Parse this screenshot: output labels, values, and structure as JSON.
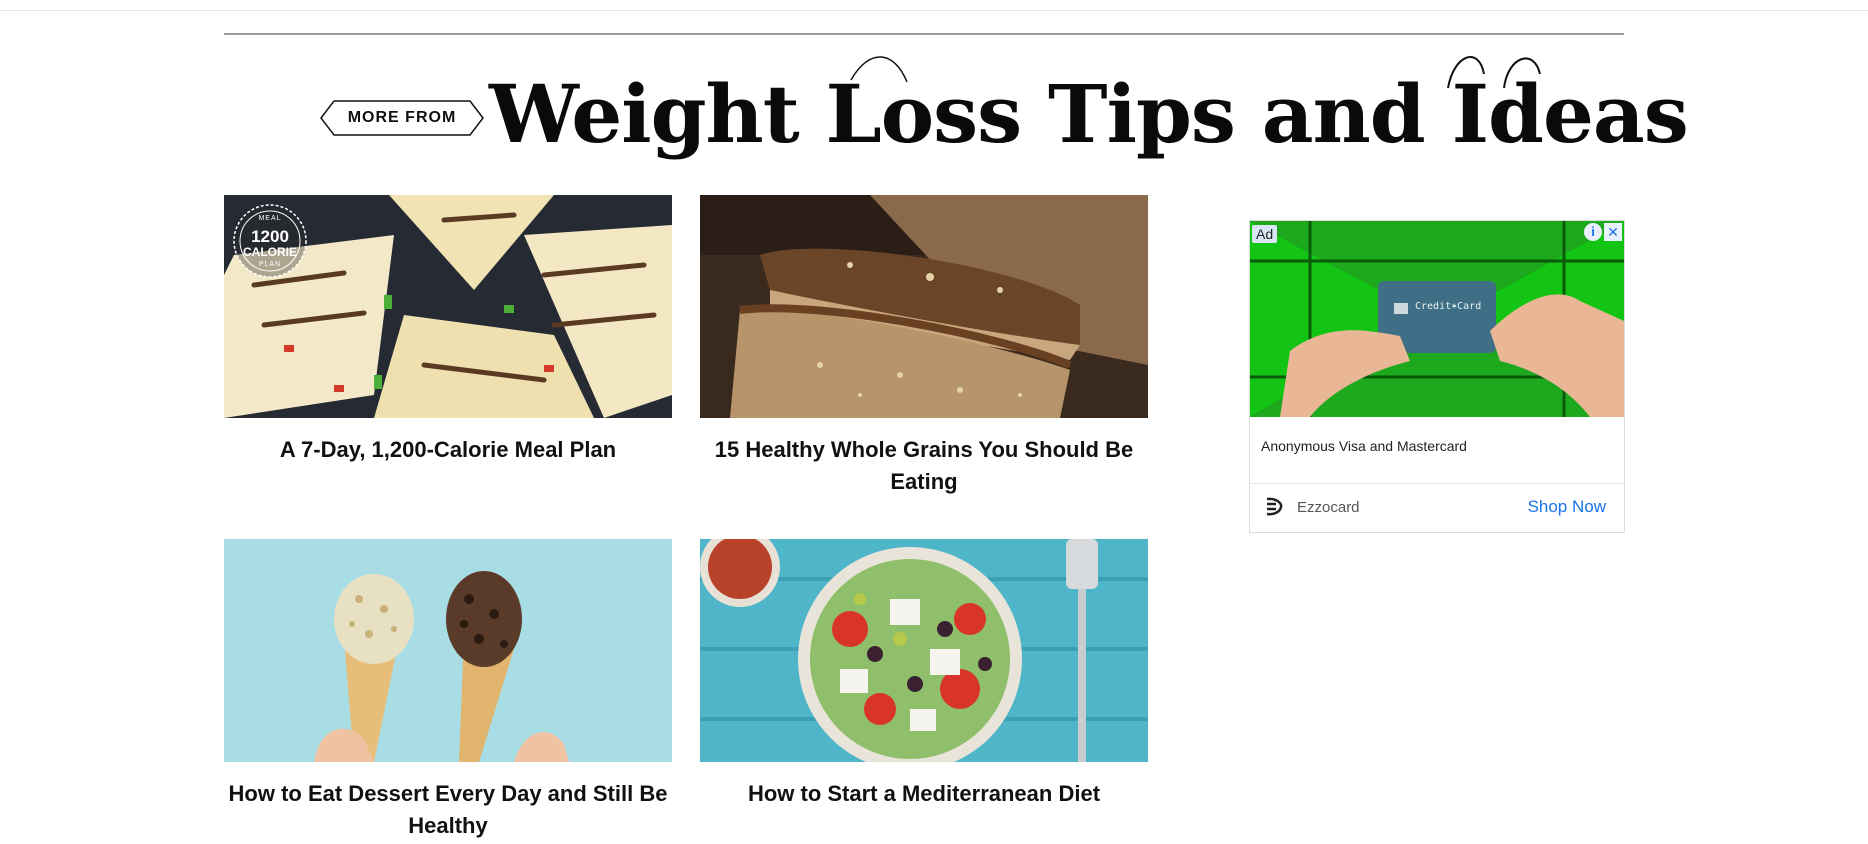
{
  "section": {
    "kicker": "MORE FROM",
    "title": "Weight Loss Tips and Ideas"
  },
  "cards": [
    {
      "headline": "A 7-Day, 1,200-Calorie Meal Plan",
      "image": "quesadilla-photo",
      "badge": {
        "top": "MEAL",
        "big": "1200",
        "mid": "CALORIE",
        "bottom": "PLAN"
      }
    },
    {
      "headline": "15 Healthy Whole Grains You Should Be Eating",
      "image": "bread-photo"
    },
    {
      "headline": "How to Eat Dessert Every Day and Still Be Healthy",
      "image": "ice-cream-photo"
    },
    {
      "headline": "How to Start a Mediterranean Diet",
      "image": "greek-salad-photo"
    }
  ],
  "ad": {
    "label": "Ad",
    "info_icon": "info-icon",
    "close_icon": "close-icon",
    "card_text": "Credit✶Card",
    "text": "Anonymous Visa and Mastercard",
    "brand": "Ezzocard",
    "cta": "Shop Now",
    "cta_color": "#1a73e8"
  }
}
